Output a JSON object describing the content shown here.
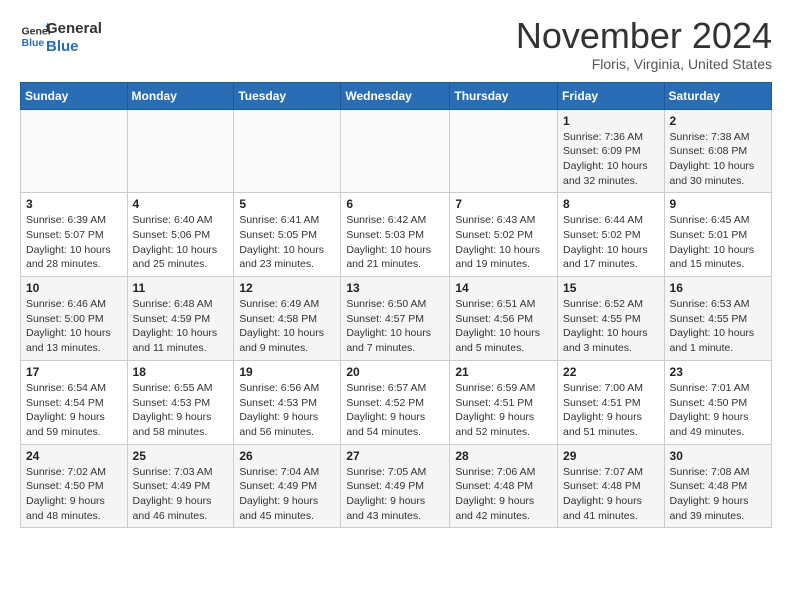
{
  "logo": {
    "line1": "General",
    "line2": "Blue"
  },
  "title": "November 2024",
  "location": "Floris, Virginia, United States",
  "weekdays": [
    "Sunday",
    "Monday",
    "Tuesday",
    "Wednesday",
    "Thursday",
    "Friday",
    "Saturday"
  ],
  "weeks": [
    [
      {
        "day": "",
        "info": ""
      },
      {
        "day": "",
        "info": ""
      },
      {
        "day": "",
        "info": ""
      },
      {
        "day": "",
        "info": ""
      },
      {
        "day": "",
        "info": ""
      },
      {
        "day": "1",
        "info": "Sunrise: 7:36 AM\nSunset: 6:09 PM\nDaylight: 10 hours\nand 32 minutes."
      },
      {
        "day": "2",
        "info": "Sunrise: 7:38 AM\nSunset: 6:08 PM\nDaylight: 10 hours\nand 30 minutes."
      }
    ],
    [
      {
        "day": "3",
        "info": "Sunrise: 6:39 AM\nSunset: 5:07 PM\nDaylight: 10 hours\nand 28 minutes."
      },
      {
        "day": "4",
        "info": "Sunrise: 6:40 AM\nSunset: 5:06 PM\nDaylight: 10 hours\nand 25 minutes."
      },
      {
        "day": "5",
        "info": "Sunrise: 6:41 AM\nSunset: 5:05 PM\nDaylight: 10 hours\nand 23 minutes."
      },
      {
        "day": "6",
        "info": "Sunrise: 6:42 AM\nSunset: 5:03 PM\nDaylight: 10 hours\nand 21 minutes."
      },
      {
        "day": "7",
        "info": "Sunrise: 6:43 AM\nSunset: 5:02 PM\nDaylight: 10 hours\nand 19 minutes."
      },
      {
        "day": "8",
        "info": "Sunrise: 6:44 AM\nSunset: 5:02 PM\nDaylight: 10 hours\nand 17 minutes."
      },
      {
        "day": "9",
        "info": "Sunrise: 6:45 AM\nSunset: 5:01 PM\nDaylight: 10 hours\nand 15 minutes."
      }
    ],
    [
      {
        "day": "10",
        "info": "Sunrise: 6:46 AM\nSunset: 5:00 PM\nDaylight: 10 hours\nand 13 minutes."
      },
      {
        "day": "11",
        "info": "Sunrise: 6:48 AM\nSunset: 4:59 PM\nDaylight: 10 hours\nand 11 minutes."
      },
      {
        "day": "12",
        "info": "Sunrise: 6:49 AM\nSunset: 4:58 PM\nDaylight: 10 hours\nand 9 minutes."
      },
      {
        "day": "13",
        "info": "Sunrise: 6:50 AM\nSunset: 4:57 PM\nDaylight: 10 hours\nand 7 minutes."
      },
      {
        "day": "14",
        "info": "Sunrise: 6:51 AM\nSunset: 4:56 PM\nDaylight: 10 hours\nand 5 minutes."
      },
      {
        "day": "15",
        "info": "Sunrise: 6:52 AM\nSunset: 4:55 PM\nDaylight: 10 hours\nand 3 minutes."
      },
      {
        "day": "16",
        "info": "Sunrise: 6:53 AM\nSunset: 4:55 PM\nDaylight: 10 hours\nand 1 minute."
      }
    ],
    [
      {
        "day": "17",
        "info": "Sunrise: 6:54 AM\nSunset: 4:54 PM\nDaylight: 9 hours\nand 59 minutes."
      },
      {
        "day": "18",
        "info": "Sunrise: 6:55 AM\nSunset: 4:53 PM\nDaylight: 9 hours\nand 58 minutes."
      },
      {
        "day": "19",
        "info": "Sunrise: 6:56 AM\nSunset: 4:53 PM\nDaylight: 9 hours\nand 56 minutes."
      },
      {
        "day": "20",
        "info": "Sunrise: 6:57 AM\nSunset: 4:52 PM\nDaylight: 9 hours\nand 54 minutes."
      },
      {
        "day": "21",
        "info": "Sunrise: 6:59 AM\nSunset: 4:51 PM\nDaylight: 9 hours\nand 52 minutes."
      },
      {
        "day": "22",
        "info": "Sunrise: 7:00 AM\nSunset: 4:51 PM\nDaylight: 9 hours\nand 51 minutes."
      },
      {
        "day": "23",
        "info": "Sunrise: 7:01 AM\nSunset: 4:50 PM\nDaylight: 9 hours\nand 49 minutes."
      }
    ],
    [
      {
        "day": "24",
        "info": "Sunrise: 7:02 AM\nSunset: 4:50 PM\nDaylight: 9 hours\nand 48 minutes."
      },
      {
        "day": "25",
        "info": "Sunrise: 7:03 AM\nSunset: 4:49 PM\nDaylight: 9 hours\nand 46 minutes."
      },
      {
        "day": "26",
        "info": "Sunrise: 7:04 AM\nSunset: 4:49 PM\nDaylight: 9 hours\nand 45 minutes."
      },
      {
        "day": "27",
        "info": "Sunrise: 7:05 AM\nSunset: 4:49 PM\nDaylight: 9 hours\nand 43 minutes."
      },
      {
        "day": "28",
        "info": "Sunrise: 7:06 AM\nSunset: 4:48 PM\nDaylight: 9 hours\nand 42 minutes."
      },
      {
        "day": "29",
        "info": "Sunrise: 7:07 AM\nSunset: 4:48 PM\nDaylight: 9 hours\nand 41 minutes."
      },
      {
        "day": "30",
        "info": "Sunrise: 7:08 AM\nSunset: 4:48 PM\nDaylight: 9 hours\nand 39 minutes."
      }
    ]
  ]
}
